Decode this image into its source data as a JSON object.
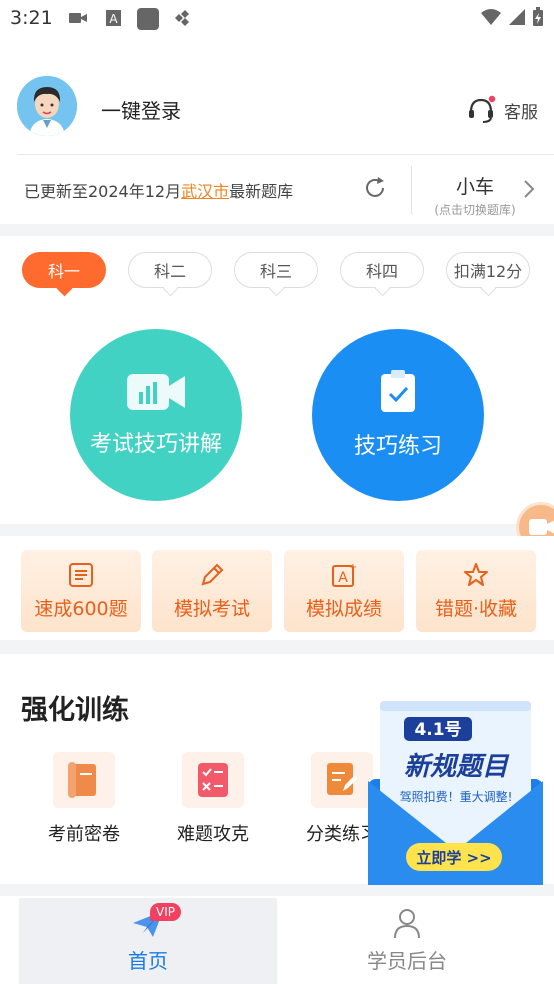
{
  "status_bar": {
    "time": "3:21",
    "icons": [
      "video-icon",
      "a-icon",
      "square-icon",
      "diamond-icon",
      "wifi-icon",
      "signal-icon",
      "battery-icon"
    ]
  },
  "header": {
    "login_label": "一键登录",
    "service_label": "客服"
  },
  "bank": {
    "prefix": "已更新至2024年12月",
    "city": "武汉市",
    "suffix": "最新题库",
    "vehicle": "小车",
    "vehicle_hint": "(点击切换题库)"
  },
  "subjects": [
    "科一",
    "科二",
    "科三",
    "科四",
    "扣满12分"
  ],
  "main_actions": {
    "tips_video": "考试技巧讲解",
    "tips_practice": "技巧练习"
  },
  "quick_actions": [
    "速成600题",
    "模拟考试",
    "模拟成绩",
    "错题·收藏"
  ],
  "training": {
    "title": "强化训练",
    "items": [
      "考前密卷",
      "难题攻克",
      "分类练习"
    ]
  },
  "promo": {
    "badge": "4.1号",
    "title": "新规题目",
    "subtitle": "驾照扣费！重大调整!",
    "button": "立即学 >>"
  },
  "bottom_nav": {
    "home": "首页",
    "home_badge": "VIP",
    "student": "学员后台"
  },
  "colors": {
    "accent_orange": "#ff6a2e",
    "teal": "#42d2c4",
    "blue": "#1a8ef2",
    "nav_active": "#1a7be6"
  }
}
